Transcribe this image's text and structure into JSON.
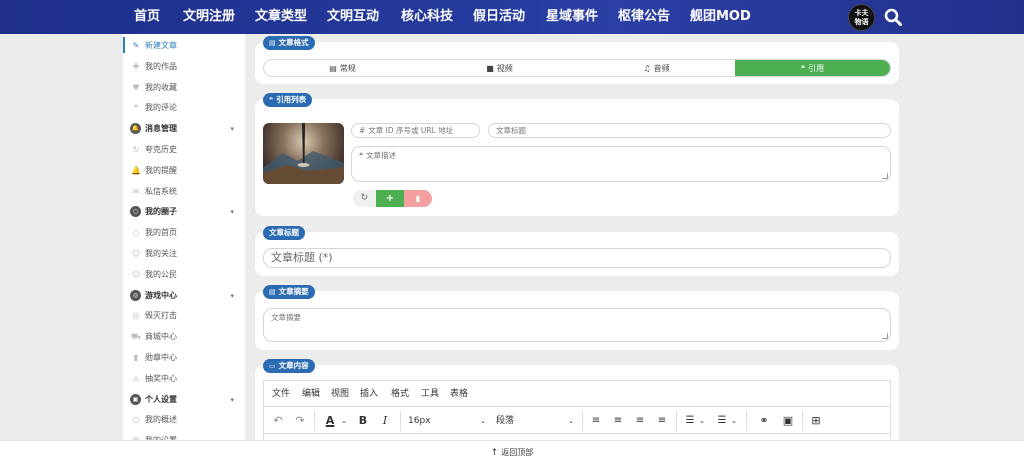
{
  "nav": {
    "items": [
      "首页",
      "文明注册",
      "文章类型",
      "文明互动",
      "核心科技",
      "假日活动",
      "星域事件",
      "枢律公告",
      "舰团MOD"
    ],
    "logo_text": "卡夫\n物语"
  },
  "sidebar": {
    "items": [
      {
        "label": "新建文章",
        "icon": "✎",
        "type": "item",
        "active": true
      },
      {
        "label": "我的作品",
        "icon": "✚",
        "type": "item"
      },
      {
        "label": "我的收藏",
        "icon": "♥",
        "type": "item"
      },
      {
        "label": "我的评论",
        "icon": "❝",
        "type": "item"
      },
      {
        "label": "消息管理",
        "icon": "🔔",
        "type": "header"
      },
      {
        "label": "夸克历史",
        "icon": "↻",
        "type": "item"
      },
      {
        "label": "我的提醒",
        "icon": "🔔",
        "type": "item"
      },
      {
        "label": "私信系统",
        "icon": "✉",
        "type": "item"
      },
      {
        "label": "我的圈子",
        "icon": "○",
        "type": "header"
      },
      {
        "label": "我的首页",
        "icon": "○",
        "type": "item"
      },
      {
        "label": "我的关注",
        "icon": "☺",
        "type": "item"
      },
      {
        "label": "我的公民",
        "icon": "☺",
        "type": "item"
      },
      {
        "label": "游戏中心",
        "icon": "◎",
        "type": "header"
      },
      {
        "label": "毁灭打击",
        "icon": "◎",
        "type": "item"
      },
      {
        "label": "商城中心",
        "icon": "⛟",
        "type": "item"
      },
      {
        "label": "勋章中心",
        "icon": "▮",
        "type": "item"
      },
      {
        "label": "抽奖中心",
        "icon": "⌂",
        "type": "item"
      },
      {
        "label": "个人设置",
        "icon": "▣",
        "type": "header"
      },
      {
        "label": "我的概述",
        "icon": "○",
        "type": "item"
      },
      {
        "label": "我的设置",
        "icon": "⚙",
        "type": "item"
      }
    ]
  },
  "format_card": {
    "title": "文章格式",
    "options": [
      {
        "label": "常规",
        "icon": "▤"
      },
      {
        "label": "视频",
        "icon": "■"
      },
      {
        "label": "音频",
        "icon": "♫"
      },
      {
        "label": "引用",
        "icon": "❝"
      }
    ],
    "selected": "引用",
    "accent": "#4caf50"
  },
  "quote_card": {
    "title": "引用列表",
    "id_placeholder": "文章 ID 序号或 URL 地址",
    "id_icon": "#",
    "title_placeholder": "文章标题",
    "desc_placeholder": "文章描述",
    "desc_icon": "❝"
  },
  "title_card": {
    "title": "文章标题",
    "placeholder": "文章标题 (*)"
  },
  "summary_card": {
    "title": "文章摘要",
    "placeholder": "文章摘要"
  },
  "content_card": {
    "title": "文章内容",
    "menu": [
      "文件",
      "编辑",
      "视图",
      "插入",
      "格式",
      "工具",
      "表格"
    ],
    "font_size": "16px",
    "block_format": "段落"
  },
  "footer": {
    "back_to_top": "返回顶部"
  },
  "colors": {
    "nav_bg": "#243a9c",
    "pill_bg": "#2b6bb3",
    "add_btn": "#4caf50",
    "delete_btn": "#f4a0a0"
  }
}
